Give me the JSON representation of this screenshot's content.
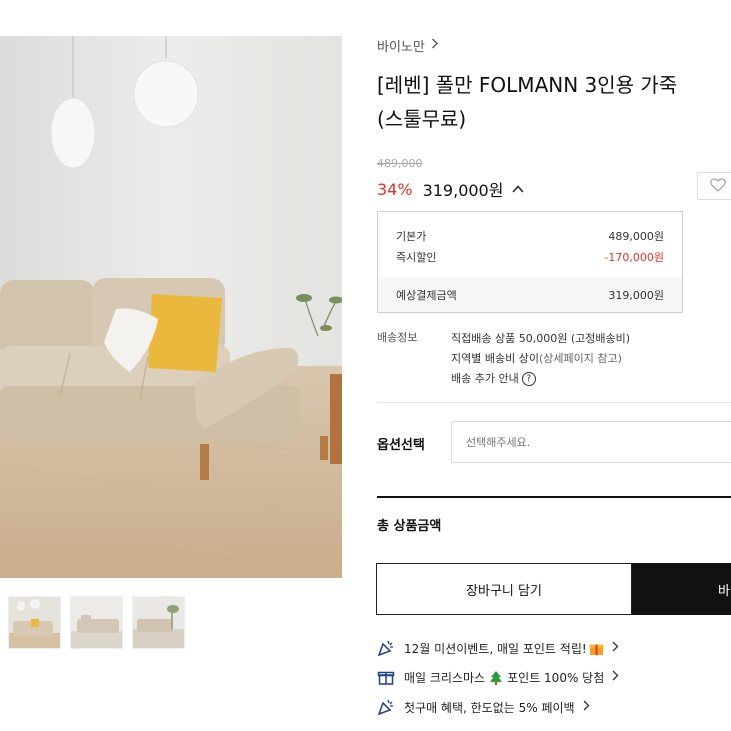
{
  "product": {
    "brand": "바이노만",
    "title_line1": "[레벤] 폴만 FOLMANN 3인용 가죽",
    "title_line2": "(스툴무료)"
  },
  "price": {
    "original": "489,000",
    "discount_rate": "34%",
    "sale_price": "319,000원"
  },
  "breakdown": {
    "base_label": "기본가",
    "base_value": "489,000원",
    "instant_label": "즉시할인",
    "instant_value": "-170,000원",
    "total_label": "예상결제금액",
    "total_value": "319,000원"
  },
  "shipping": {
    "label": "배송정보",
    "line1": "직접배송 상품 50,000원 (고정배송비)",
    "line2_a": "지역별 배송비 상이",
    "line2_b": "(상세페이지 참고)",
    "line3": "배송 추가 안내",
    "help_symbol": "?"
  },
  "options": {
    "label": "옵션선택",
    "placeholder": "선택해주세요."
  },
  "total": {
    "label": "총 상품금액"
  },
  "buttons": {
    "cart": "장바구니 담기",
    "buy": "바"
  },
  "promos": [
    {
      "text": "12월 미션이벤트, 매일 포인트 적립!",
      "icon": "party-popper-icon"
    },
    {
      "text": "매일 크리스마스",
      "text_b": "포인트 100% 당첨",
      "icon": "gift-icon"
    },
    {
      "text": "첫구매 혜택, 한도없는 5% 페이백",
      "icon": "party-popper-icon"
    }
  ],
  "colors": {
    "discount": "#e0312a",
    "buy_button": "#111111",
    "accent_gift": "#f2a01e",
    "tree": "#2e9a3b"
  }
}
